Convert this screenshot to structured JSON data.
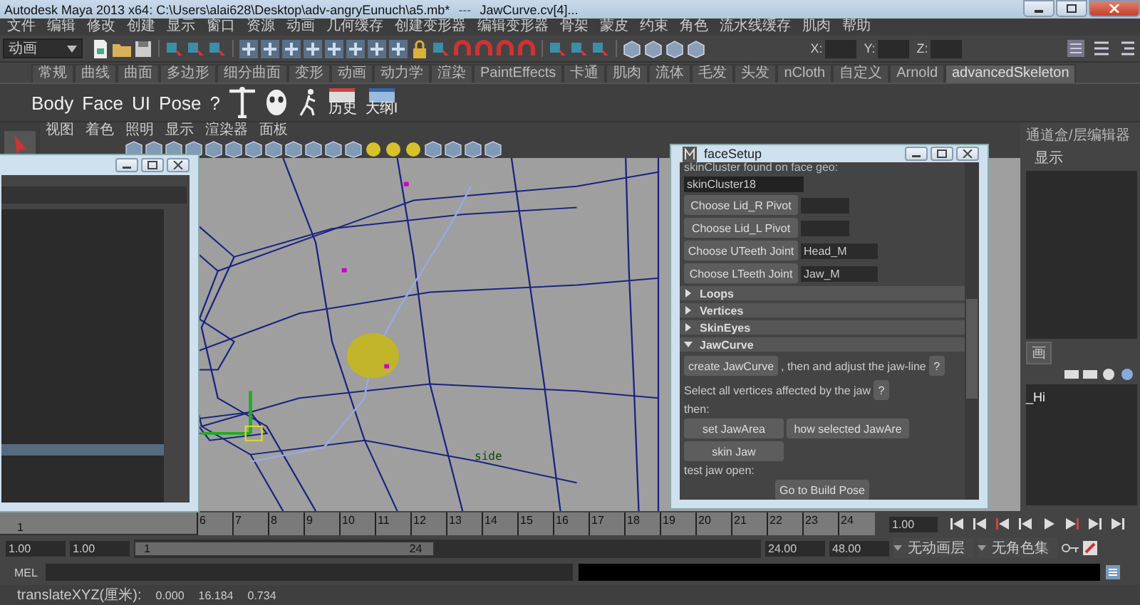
{
  "window": {
    "title": "Autodesk Maya 2013 x64: C:\\Users\\alai628\\Desktop\\adv-angryEunuch\\a5.mb*",
    "separator": "---",
    "selection": "JawCurve.cv[4]..."
  },
  "menu_bar": [
    "文件",
    "编辑",
    "修改",
    "创建",
    "显示",
    "窗口",
    "资源",
    "动画",
    "几何缓存",
    "创建变形器",
    "编辑变形器",
    "骨架",
    "蒙皮",
    "约束",
    "角色",
    "流水线缓存",
    "肌肉",
    "帮助"
  ],
  "status_line": {
    "mode": "动画",
    "x_label": "X:",
    "y_label": "Y:",
    "z_label": "Z:"
  },
  "shelf_tabs": [
    {
      "label": "常规",
      "selected": false
    },
    {
      "label": "曲线",
      "selected": false
    },
    {
      "label": "曲面",
      "selected": false
    },
    {
      "label": "多边形",
      "selected": false
    },
    {
      "label": "细分曲面",
      "selected": false
    },
    {
      "label": "变形",
      "selected": false
    },
    {
      "label": "动画",
      "selected": false
    },
    {
      "label": "动力学",
      "selected": false
    },
    {
      "label": "渲染",
      "selected": false
    },
    {
      "label": "PaintEffects",
      "selected": false
    },
    {
      "label": "卡通",
      "selected": false
    },
    {
      "label": "肌肉",
      "selected": false
    },
    {
      "label": "流体",
      "selected": false
    },
    {
      "label": "毛发",
      "selected": false
    },
    {
      "label": "头发",
      "selected": false
    },
    {
      "label": "nCloth",
      "selected": false
    },
    {
      "label": "自定义",
      "selected": false
    },
    {
      "label": "Arnold",
      "selected": false
    },
    {
      "label": "advancedSkeleton",
      "selected": true
    }
  ],
  "shelf": {
    "buttons": [
      "Body",
      "Face",
      "UI",
      "Pose",
      "?"
    ],
    "icon_labels": [
      "历史",
      "大纲I"
    ]
  },
  "viewport": {
    "menu": [
      "视图",
      "着色",
      "照明",
      "显示",
      "渲染器",
      "面板"
    ],
    "camera_label": "side"
  },
  "channel_box": {
    "title": "通道盒/层编辑器",
    "menu": "显示",
    "layer_tab": "画",
    "item": "_Hi"
  },
  "face_setup": {
    "title": "faceSetup",
    "caption": "skinCluster found on face geo:",
    "skin_cluster": "skinCluster18",
    "pickers": [
      {
        "button": "Choose Lid_R Pivot"
      },
      {
        "button": "Choose Lid_L Pivot"
      },
      {
        "button": "Choose UTeeth Joint",
        "value": "Head_M"
      },
      {
        "button": "Choose LTeeth Joint",
        "value": "Jaw_M"
      }
    ],
    "sections": [
      {
        "label": "Loops",
        "expanded": false
      },
      {
        "label": "Vertices",
        "expanded": false
      },
      {
        "label": "SkinEyes",
        "expanded": false
      },
      {
        "label": "JawCurve",
        "expanded": true
      }
    ],
    "create_button": "create JawCurve",
    "create_note": ", then and adjust the jaw-line",
    "help_button": "?",
    "select_note": "Select all vertices affected by the jaw",
    "select_help": "?",
    "then": "then:",
    "set_button": "set JawArea",
    "show_button": "how selected JawAre",
    "skin_button": "skin Jaw",
    "test_label": "test jaw open:",
    "build_pose_button": "Go to Build Pose"
  },
  "timeline": {
    "start_label": "1",
    "ticks": [
      "6",
      "7",
      "8",
      "9",
      "10",
      "11",
      "12",
      "13",
      "14",
      "15",
      "16",
      "17",
      "18",
      "19",
      "20",
      "21",
      "22",
      "23",
      "24"
    ],
    "current_time": "1.00"
  },
  "range": {
    "level": 0.48,
    "start": "1.00",
    "min": "1.00",
    "slider_start": "1",
    "slider_end": "24",
    "end": "24.00",
    "max": "48.00",
    "anim_layer": "无动画层",
    "char_set": "无角色集"
  },
  "command_line": {
    "language": "MEL"
  },
  "help_line": {
    "label": "translateXYZ(厘米):",
    "values": [
      "0.000",
      "16.184",
      "0.734"
    ]
  }
}
